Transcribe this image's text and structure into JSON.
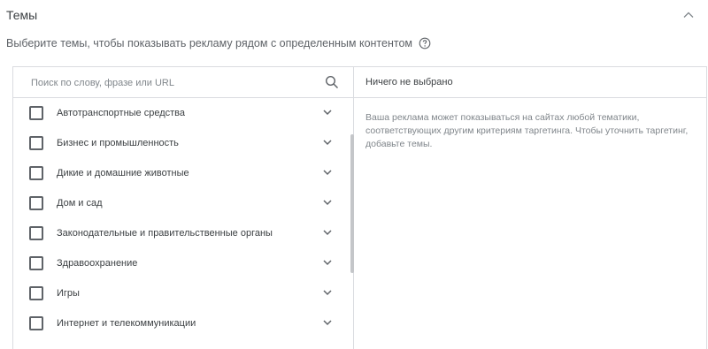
{
  "section": {
    "title": "Темы",
    "subtitle": "Выберите темы, чтобы показывать рекламу рядом с определенным контентом"
  },
  "search": {
    "placeholder": "Поиск по слову, фразе или URL"
  },
  "topics": [
    {
      "label": "Автотранспортные средства",
      "checked": false
    },
    {
      "label": "Бизнес и промышленность",
      "checked": false
    },
    {
      "label": "Дикие и домашние животные",
      "checked": false
    },
    {
      "label": "Дом и сад",
      "checked": false
    },
    {
      "label": "Законодательные и правительственные органы",
      "checked": false
    },
    {
      "label": "Здравоохранение",
      "checked": false
    },
    {
      "label": "Игры",
      "checked": false
    },
    {
      "label": "Интернет и телекоммуникации",
      "checked": false
    }
  ],
  "selected_pane": {
    "header": "Ничего не выбрано",
    "description": "Ваша реклама может показываться на сайтах любой тематики, соответствующих другим критериям таргетинга. Чтобы уточнить таргетинг, добавьте темы."
  },
  "icons": {
    "collapse": "chevron-up-icon",
    "help": "help-circle-icon",
    "search": "search-icon",
    "expand": "chevron-down-icon"
  }
}
